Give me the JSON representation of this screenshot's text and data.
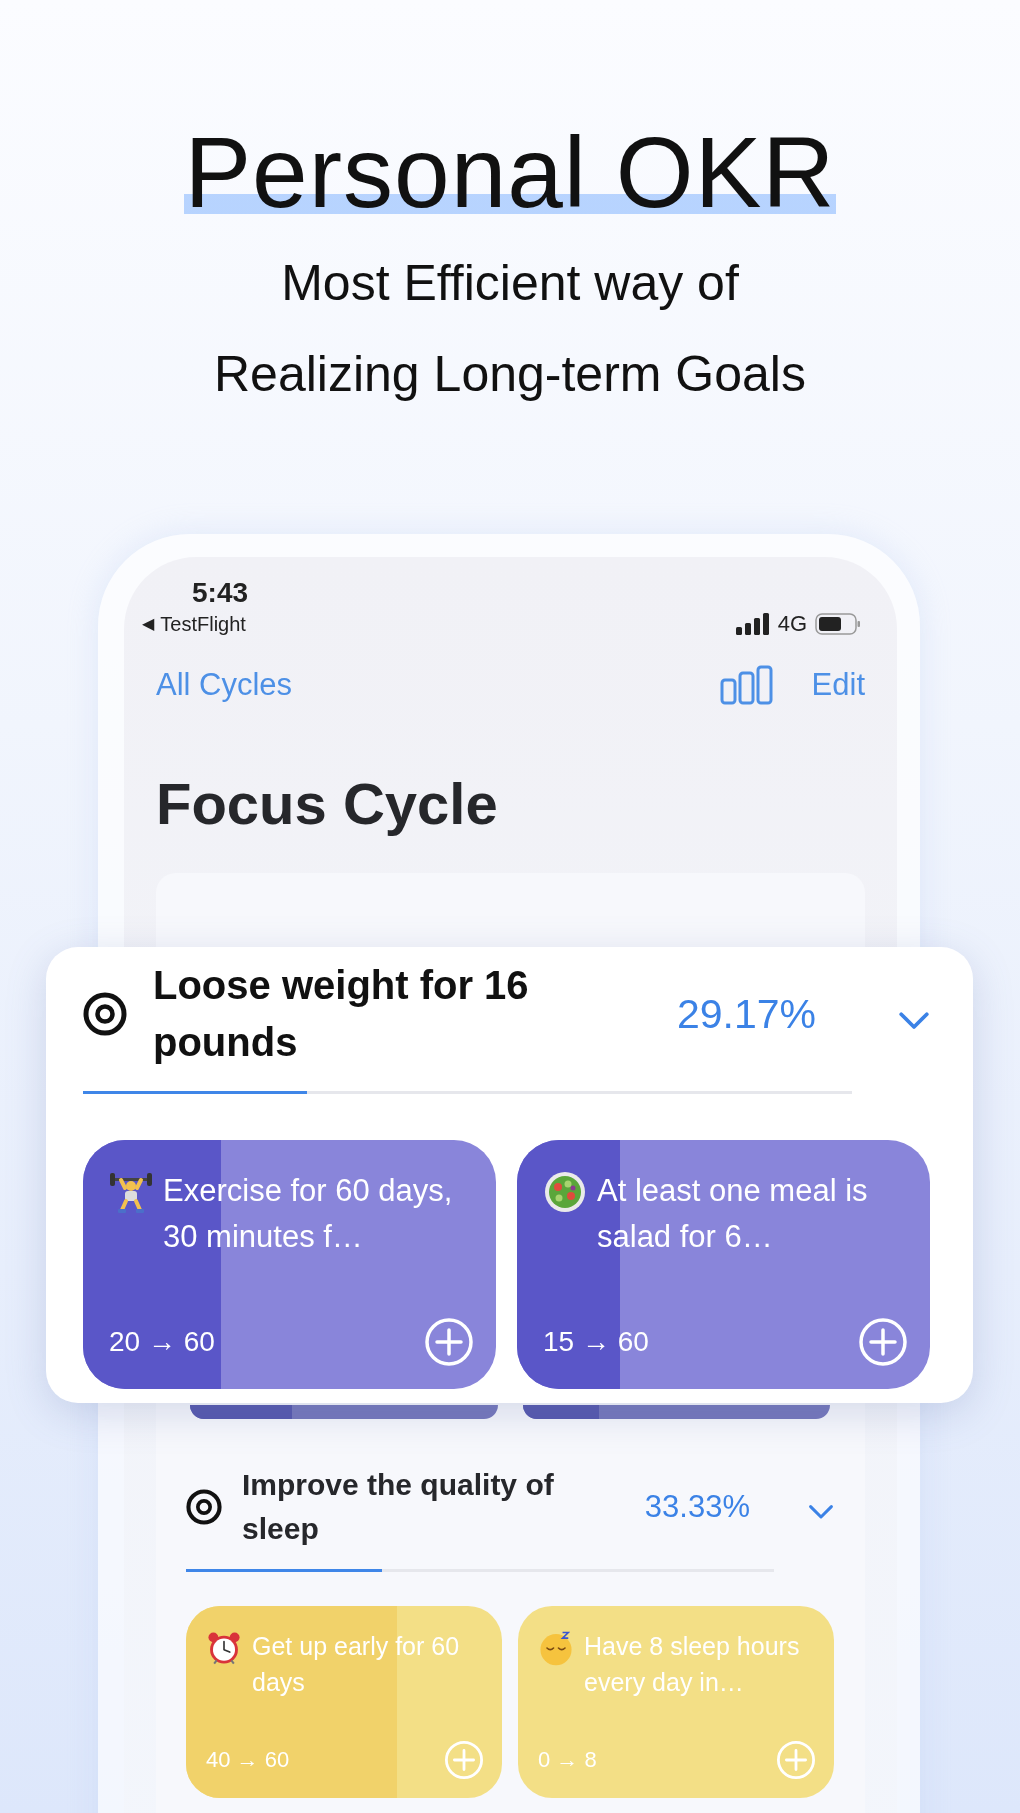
{
  "headline": {
    "title": "Personal OKR",
    "subtitle_lines": [
      "Most Efficient way of",
      "Realizing Long-term Goals"
    ]
  },
  "status_bar": {
    "time": "5:43",
    "back_arrow": "◀",
    "back_app": "TestFlight",
    "network": "4G"
  },
  "nav": {
    "back": "All Cycles",
    "edit": "Edit"
  },
  "title": "Focus Cycle",
  "objectives": [
    {
      "title": "Loose weight for 16 pounds",
      "percent": "29.17%",
      "level": 0.2917,
      "key_results": [
        {
          "text": "Exercise for 60 days, 30 minutes f…",
          "progress": "20 → 60",
          "level": 0.333
        },
        {
          "text": "At least one meal is salad for 6…",
          "progress": "15 → 60",
          "level": 0.25
        }
      ]
    },
    {
      "title": "Improve the quality of sleep",
      "percent": "33.33%",
      "level": 0.3333,
      "key_results": [
        {
          "text": "Get up early for 60 days",
          "progress": "40 → 60",
          "level": 0.667
        },
        {
          "text": "Have 8 sleep hours every day in…",
          "progress": "0 → 8"
        }
      ]
    }
  ]
}
